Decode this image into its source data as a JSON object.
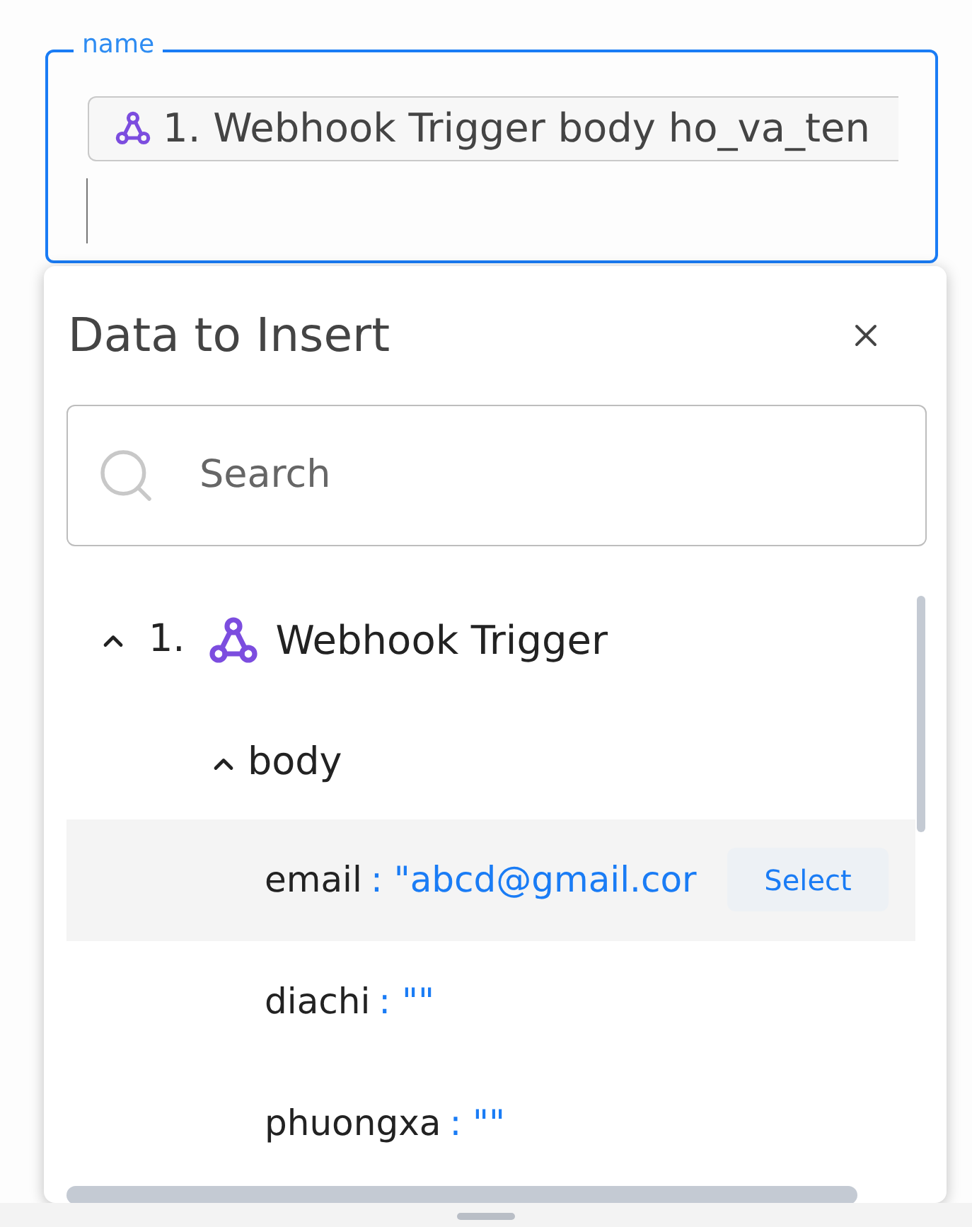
{
  "field": {
    "label": "name",
    "chip": "1. Webhook Trigger body ho_va_ten"
  },
  "panel": {
    "title": "Data to Insert",
    "search": {
      "placeholder": "Search"
    },
    "tree": [
      {
        "number": "1.",
        "label": "Webhook Trigger",
        "expanded": true,
        "children": [
          {
            "label": "body",
            "expanded": true,
            "children": [
              {
                "key": "email",
                "value": ": \"abcd@gmail.cor",
                "selected": true
              },
              {
                "key": "diachi",
                "value": ": \"\"",
                "selected": false
              },
              {
                "key": "phuongxa",
                "value": ": \"\"",
                "selected": false
              }
            ]
          }
        ]
      }
    ],
    "select_button": "Select"
  }
}
